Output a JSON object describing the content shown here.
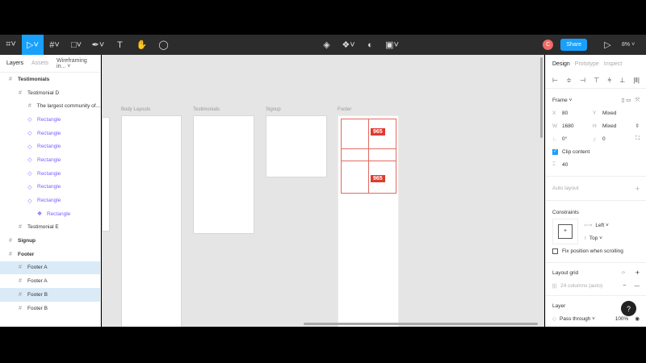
{
  "toolbar": {
    "share": "Share",
    "zoom": "8%",
    "avatar": "C"
  },
  "layers_panel": {
    "tabs": [
      "Layers",
      "Assets"
    ],
    "page": "Wireframing in...",
    "rows": [
      {
        "label": "Testimonials",
        "icon": "frame-icon",
        "indent": 0,
        "bold": true
      },
      {
        "label": "Testimonial D",
        "icon": "frame-icon",
        "indent": 1
      },
      {
        "label": "The largest community of...",
        "icon": "frame-icon",
        "indent": 2
      },
      {
        "label": "Rectangle",
        "icon": "component-instance-icon",
        "indent": 2,
        "purple": true
      },
      {
        "label": "Rectangle",
        "icon": "component-instance-icon",
        "indent": 2,
        "purple": true
      },
      {
        "label": "Rectangle",
        "icon": "component-instance-icon",
        "indent": 2,
        "purple": true
      },
      {
        "label": "Rectangle",
        "icon": "component-instance-icon",
        "indent": 2,
        "purple": true
      },
      {
        "label": "Rectangle",
        "icon": "component-instance-icon",
        "indent": 2,
        "purple": true
      },
      {
        "label": "Rectangle",
        "icon": "component-instance-icon",
        "indent": 2,
        "purple": true
      },
      {
        "label": "Rectangle",
        "icon": "component-instance-icon",
        "indent": 2,
        "purple": true
      },
      {
        "label": "Rectangle",
        "icon": "component-icon",
        "indent": 3,
        "purple": true
      },
      {
        "label": "Testimonial E",
        "icon": "frame-icon",
        "indent": 1
      },
      {
        "label": "Signup",
        "icon": "frame-icon",
        "indent": 0,
        "bold": true
      },
      {
        "label": "Footer",
        "icon": "frame-icon",
        "indent": 0,
        "bold": true
      },
      {
        "label": "Footer A",
        "icon": "frame-icon",
        "indent": 1,
        "selected": true
      },
      {
        "label": "Footer A",
        "icon": "frame-icon",
        "indent": 1
      },
      {
        "label": "Footer B",
        "icon": "frame-icon",
        "indent": 1,
        "selected": true
      },
      {
        "label": "Footer B",
        "icon": "frame-icon",
        "indent": 1
      }
    ]
  },
  "canvas": {
    "frames": [
      "Body Layouts",
      "Testimonials",
      "Signup",
      "Footer"
    ],
    "badge": "965"
  },
  "design_panel": {
    "tabs": [
      "Design",
      "Prototype",
      "Inspect"
    ],
    "frame_label": "Frame",
    "x": "80",
    "y": "Mixed",
    "w": "1680",
    "h": "Mixed",
    "rotation": "0°",
    "radius": "0",
    "clip_content": "Clip content",
    "spacing": "40",
    "auto_layout": "Auto layout",
    "constraints": "Constraints",
    "h_constraint": "Left",
    "v_constraint": "Top",
    "fix_position": "Fix position when scrolling",
    "layout_grid": "Layout grid",
    "grid_value": "24 columns (auto)",
    "layer": "Layer",
    "blend": "Pass through",
    "opacity": "100%",
    "help": "?"
  },
  "colors": {
    "accent": "#18a0fb",
    "selection": "#e03a2f",
    "avatar": "#f06a6a"
  }
}
